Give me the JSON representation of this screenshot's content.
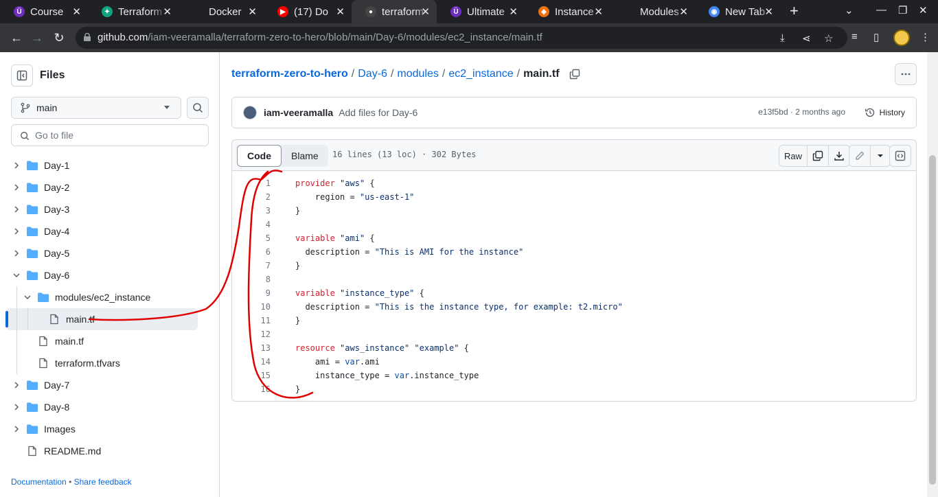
{
  "browser": {
    "tabs": [
      {
        "title": "Course",
        "favicon_color": "#6f2dbd",
        "favicon": "Ü"
      },
      {
        "title": "Terraform",
        "favicon_color": "#10a37f",
        "favicon": "✦"
      },
      {
        "title": "Docker",
        "favicon_color": "#202124",
        "favicon": ""
      },
      {
        "title": "(17) Do",
        "favicon_color": "#ff0000",
        "favicon": "▶"
      },
      {
        "title": "terraform",
        "favicon_color": "#444",
        "favicon": "●"
      },
      {
        "title": "Ultimate",
        "favicon_color": "#6f2dbd",
        "favicon": "Ü"
      },
      {
        "title": "Instance",
        "favicon_color": "#ec7211",
        "favicon": "◈"
      },
      {
        "title": "Modules",
        "favicon_color": "#202124",
        "favicon": ""
      },
      {
        "title": "New Tab",
        "favicon_color": "#4285f4",
        "favicon": "◉"
      }
    ],
    "url_host": "github.com",
    "url_path": "/iam-veeramalla/terraform-zero-to-hero/blob/main/Day-6/modules/ec2_instance/main.tf"
  },
  "sidebar": {
    "title": "Files",
    "branch": "main",
    "goto_placeholder": "Go to file",
    "items": [
      {
        "label": "Day-1",
        "type": "folder",
        "depth": 0,
        "open": false
      },
      {
        "label": "Day-2",
        "type": "folder",
        "depth": 0,
        "open": false
      },
      {
        "label": "Day-3",
        "type": "folder",
        "depth": 0,
        "open": false
      },
      {
        "label": "Day-4",
        "type": "folder",
        "depth": 0,
        "open": false
      },
      {
        "label": "Day-5",
        "type": "folder",
        "depth": 0,
        "open": false
      },
      {
        "label": "Day-6",
        "type": "folder",
        "depth": 0,
        "open": true
      },
      {
        "label": "modules/ec2_instance",
        "type": "folder",
        "depth": 1,
        "open": true
      },
      {
        "label": "main.tf",
        "type": "file",
        "depth": 2,
        "selected": true
      },
      {
        "label": "main.tf",
        "type": "file",
        "depth": 1
      },
      {
        "label": "terraform.tfvars",
        "type": "file",
        "depth": 1
      },
      {
        "label": "Day-7",
        "type": "folder",
        "depth": 0,
        "open": false
      },
      {
        "label": "Day-8",
        "type": "folder",
        "depth": 0,
        "open": false
      },
      {
        "label": "Images",
        "type": "folder",
        "depth": 0,
        "open": false
      },
      {
        "label": "README.md",
        "type": "file",
        "depth": 0
      }
    ],
    "footer": {
      "docs": "Documentation",
      "sep": "•",
      "feedback": "Share feedback"
    }
  },
  "breadcrumb": {
    "repo": "terraform-zero-to-hero",
    "parts": [
      "Day-6",
      "modules",
      "ec2_instance"
    ],
    "sep": "/",
    "file": "main.tf"
  },
  "commit": {
    "author": "iam-veeramalla",
    "message": "Add files for Day-6",
    "meta": "e13f5bd · 2 months ago",
    "history": "History"
  },
  "file": {
    "tab_code": "Code",
    "tab_blame": "Blame",
    "info": "16 lines (13 loc) · 302 Bytes",
    "raw": "Raw",
    "lines": [
      [
        [
          "k",
          "provider"
        ],
        [
          "t",
          " "
        ],
        [
          "s",
          "\"aws\""
        ],
        [
          "t",
          " {"
        ]
      ],
      [
        [
          "t",
          "    region = "
        ],
        [
          "s",
          "\"us-east-1\""
        ]
      ],
      [
        [
          "t",
          "}"
        ]
      ],
      [],
      [
        [
          "k",
          "variable"
        ],
        [
          "t",
          " "
        ],
        [
          "s",
          "\"ami\""
        ],
        [
          "t",
          " {"
        ]
      ],
      [
        [
          "t",
          "  description = "
        ],
        [
          "s",
          "\"This is AMI for the instance\""
        ]
      ],
      [
        [
          "t",
          "}"
        ]
      ],
      [],
      [
        [
          "k",
          "variable"
        ],
        [
          "t",
          " "
        ],
        [
          "s",
          "\"instance_type\""
        ],
        [
          "t",
          " {"
        ]
      ],
      [
        [
          "t",
          "  description = "
        ],
        [
          "s",
          "\"This is the instance type, for example: t2.micro\""
        ]
      ],
      [
        [
          "t",
          "}"
        ]
      ],
      [],
      [
        [
          "k",
          "resource"
        ],
        [
          "t",
          " "
        ],
        [
          "s",
          "\"aws_instance\""
        ],
        [
          "t",
          " "
        ],
        [
          "s",
          "\"example\""
        ],
        [
          "t",
          " {"
        ]
      ],
      [
        [
          "t",
          "    ami = "
        ],
        [
          "v",
          "var"
        ],
        [
          "t",
          ".ami"
        ]
      ],
      [
        [
          "t",
          "    instance_type = "
        ],
        [
          "v",
          "var"
        ],
        [
          "t",
          ".instance_type"
        ]
      ],
      [
        [
          "t",
          "}"
        ]
      ]
    ]
  },
  "colors": {
    "link": "#0969da",
    "annotation": "#e00000"
  }
}
